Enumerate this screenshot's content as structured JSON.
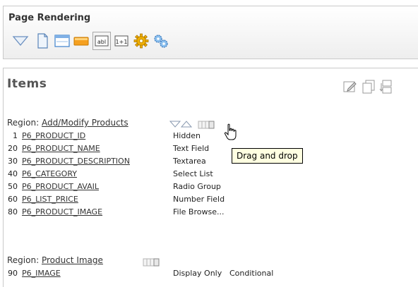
{
  "page_rendering": {
    "title": "Page Rendering",
    "toolbar_icons": [
      "collapse-triangle-icon",
      "page-icon",
      "region-icon",
      "button-icon",
      "text-item-icon",
      "computation-icon",
      "process-gear-icon",
      "branch-gears-icon"
    ]
  },
  "items": {
    "title": "Items",
    "tools_icons": [
      "edit-all-icon",
      "copy-icon",
      "reorder-icon"
    ],
    "regions": [
      {
        "prefix": "Region:",
        "name": "Add/Modify Products",
        "rows": [
          {
            "seq": "1",
            "name": "P6_PRODUCT_ID",
            "type": "Hidden",
            "condition": ""
          },
          {
            "seq": "20",
            "name": "P6_PRODUCT_NAME",
            "type": "Text Field",
            "condition": ""
          },
          {
            "seq": "30",
            "name": "P6_PRODUCT_DESCRIPTION",
            "type": "Textarea",
            "condition": ""
          },
          {
            "seq": "40",
            "name": "P6_CATEGORY",
            "type": "Select List",
            "condition": ""
          },
          {
            "seq": "50",
            "name": "P6_PRODUCT_AVAIL",
            "type": "Radio Group",
            "condition": ""
          },
          {
            "seq": "60",
            "name": "P6_LIST_PRICE",
            "type": "Number Field",
            "condition": ""
          },
          {
            "seq": "80",
            "name": "P6_PRODUCT_IMAGE",
            "type": "File Browse...",
            "condition": ""
          }
        ]
      },
      {
        "prefix": "Region:",
        "name": "Product Image",
        "rows": [
          {
            "seq": "90",
            "name": "P6_IMAGE",
            "type": "Display Only",
            "condition": "Conditional"
          }
        ]
      }
    ]
  },
  "tooltip": {
    "text": "Drag and drop"
  },
  "colors": {
    "panel_border": "#c9c9c9",
    "tooltip_bg": "#ffffe1",
    "icon_blue": "#4a8ad0",
    "icon_gold": "#f0b000"
  }
}
